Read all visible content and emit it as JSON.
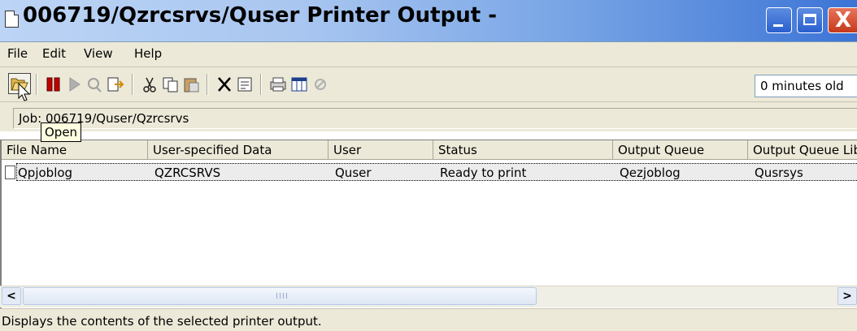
{
  "window": {
    "title": "006719/Qzrcsrvs/Quser Printer Output -",
    "close_glyph": "X"
  },
  "menu": {
    "items": [
      "File",
      "Edit",
      "View",
      "Help"
    ]
  },
  "toolbar": {
    "icons": [
      "open-icon",
      "hold-icon",
      "release-icon",
      "reply-icon",
      "move-icon",
      "cut-icon",
      "copy-icon",
      "paste-icon",
      "delete-icon",
      "properties-icon",
      "printer-icon",
      "columns-icon",
      "stop-icon"
    ],
    "age_text": "0 minutes old"
  },
  "job": {
    "path_label": "Job: 006719/Quser/Qzrcsrvs"
  },
  "tooltip": {
    "text": "Open"
  },
  "table": {
    "columns": [
      "File Name",
      "User-specified Data",
      "User",
      "Status",
      "Output Queue",
      "Output Queue Library"
    ],
    "rows": [
      [
        "Qpjoblog",
        "QZRCSRVS",
        "Quser",
        "Ready to print",
        "Qezjoblog",
        "Qusrsys"
      ]
    ]
  },
  "scrollbar": {
    "left_glyph": "<",
    "right_glyph": ">",
    "thumb_grip": "IIII"
  },
  "status": {
    "text": "Displays the contents of the selected printer output."
  }
}
